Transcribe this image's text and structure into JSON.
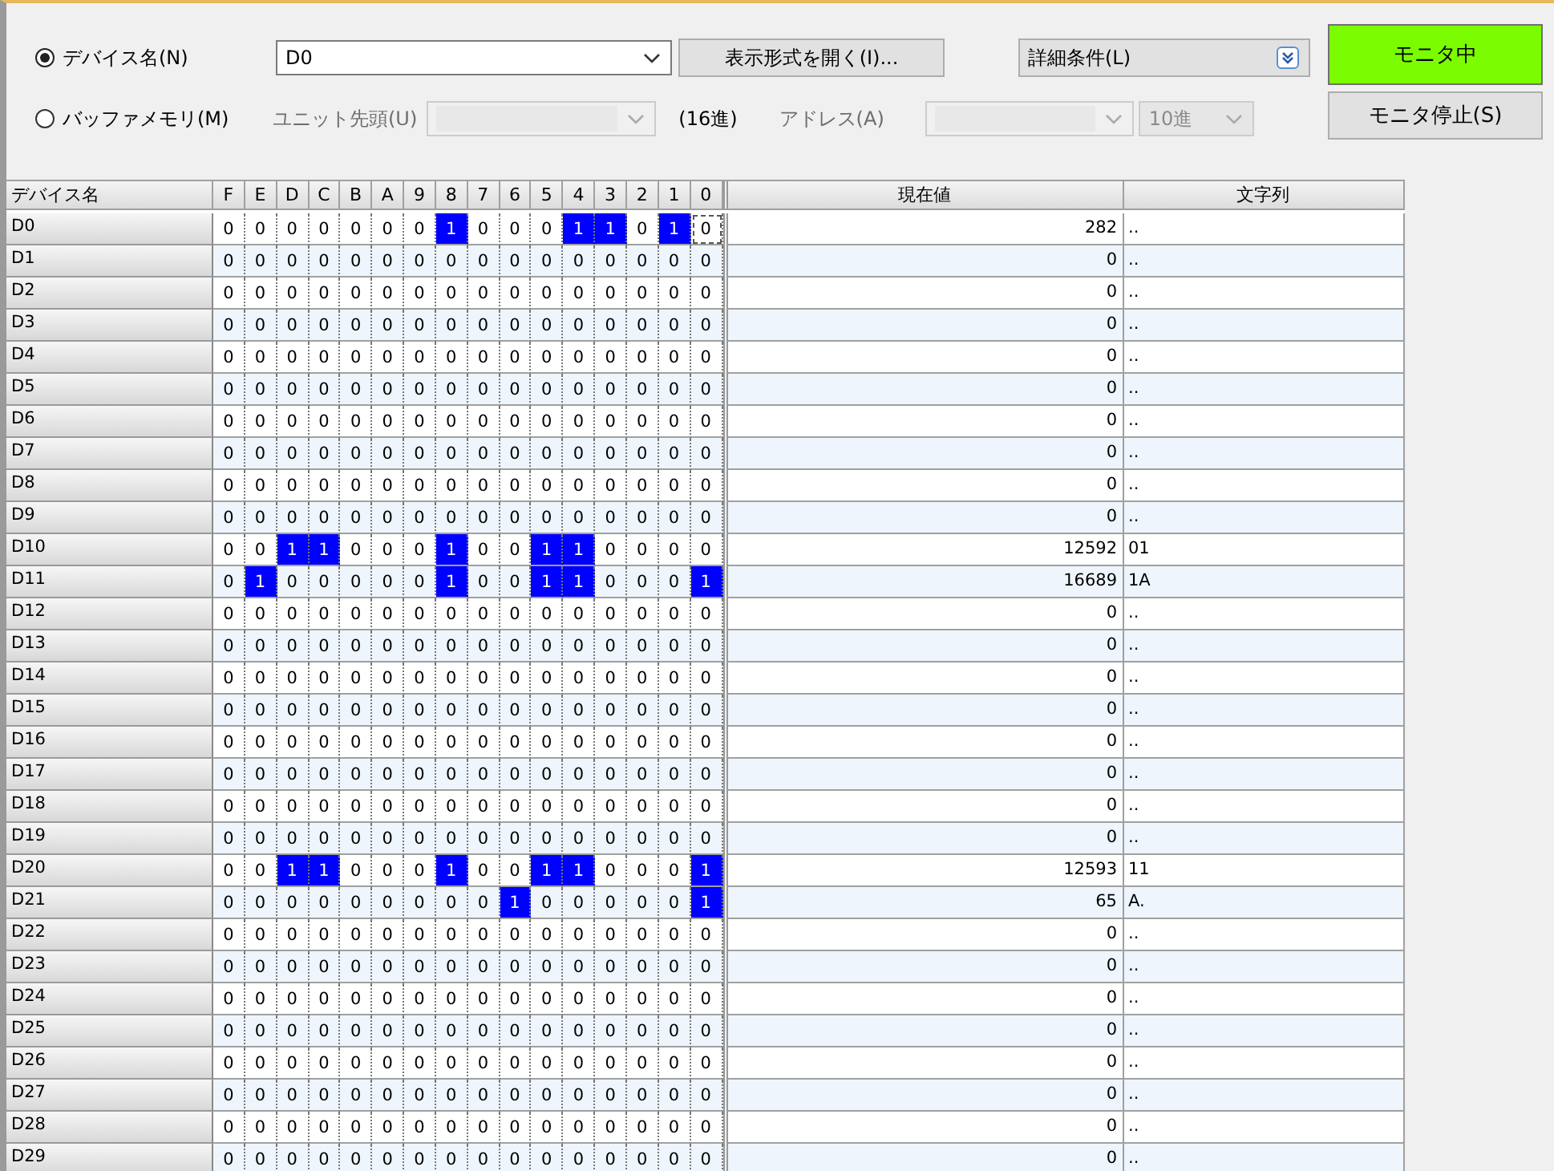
{
  "radios": [
    {
      "label": "デバイス名(N)",
      "selected": true
    },
    {
      "label": "バッファメモリ(M)",
      "selected": false
    }
  ],
  "device_field": {
    "value": "D0"
  },
  "open_format_button": "表示形式を開く(I)...",
  "detail_condition": {
    "value": "詳細条件(L)"
  },
  "monitor_button": {
    "label": "モニタ中",
    "active": true
  },
  "stop_button": "モニタ停止(S)",
  "unit_start": {
    "label": "ユニット先頭(U)",
    "disabled": true
  },
  "unit_radix": "(16進)",
  "address": {
    "label": "アドレス(A)",
    "disabled": true
  },
  "address_radix": {
    "value": "10進",
    "disabled": true
  },
  "table": {
    "columns": [
      "デバイス名",
      "F",
      "E",
      "D",
      "C",
      "B",
      "A",
      "9",
      "8",
      "7",
      "6",
      "5",
      "4",
      "3",
      "2",
      "1",
      "0",
      "現在値",
      "文字列"
    ],
    "rows": [
      {
        "name": "D0",
        "focused": true,
        "bits": [
          "0",
          "0",
          "0",
          "0",
          "0",
          "0",
          "0",
          "1",
          "0",
          "0",
          "0",
          "1",
          "1",
          "0",
          "1",
          "0"
        ],
        "value": "282",
        "text": ".."
      },
      {
        "name": "D1",
        "focused": false,
        "bits": [
          "0",
          "0",
          "0",
          "0",
          "0",
          "0",
          "0",
          "0",
          "0",
          "0",
          "0",
          "0",
          "0",
          "0",
          "0",
          "0"
        ],
        "value": "0",
        "text": ".."
      },
      {
        "name": "D2",
        "focused": false,
        "bits": [
          "0",
          "0",
          "0",
          "0",
          "0",
          "0",
          "0",
          "0",
          "0",
          "0",
          "0",
          "0",
          "0",
          "0",
          "0",
          "0"
        ],
        "value": "0",
        "text": ".."
      },
      {
        "name": "D3",
        "focused": false,
        "bits": [
          "0",
          "0",
          "0",
          "0",
          "0",
          "0",
          "0",
          "0",
          "0",
          "0",
          "0",
          "0",
          "0",
          "0",
          "0",
          "0"
        ],
        "value": "0",
        "text": ".."
      },
      {
        "name": "D4",
        "focused": false,
        "bits": [
          "0",
          "0",
          "0",
          "0",
          "0",
          "0",
          "0",
          "0",
          "0",
          "0",
          "0",
          "0",
          "0",
          "0",
          "0",
          "0"
        ],
        "value": "0",
        "text": ".."
      },
      {
        "name": "D5",
        "focused": false,
        "bits": [
          "0",
          "0",
          "0",
          "0",
          "0",
          "0",
          "0",
          "0",
          "0",
          "0",
          "0",
          "0",
          "0",
          "0",
          "0",
          "0"
        ],
        "value": "0",
        "text": ".."
      },
      {
        "name": "D6",
        "focused": false,
        "bits": [
          "0",
          "0",
          "0",
          "0",
          "0",
          "0",
          "0",
          "0",
          "0",
          "0",
          "0",
          "0",
          "0",
          "0",
          "0",
          "0"
        ],
        "value": "0",
        "text": ".."
      },
      {
        "name": "D7",
        "focused": false,
        "bits": [
          "0",
          "0",
          "0",
          "0",
          "0",
          "0",
          "0",
          "0",
          "0",
          "0",
          "0",
          "0",
          "0",
          "0",
          "0",
          "0"
        ],
        "value": "0",
        "text": ".."
      },
      {
        "name": "D8",
        "focused": false,
        "bits": [
          "0",
          "0",
          "0",
          "0",
          "0",
          "0",
          "0",
          "0",
          "0",
          "0",
          "0",
          "0",
          "0",
          "0",
          "0",
          "0"
        ],
        "value": "0",
        "text": ".."
      },
      {
        "name": "D9",
        "focused": false,
        "bits": [
          "0",
          "0",
          "0",
          "0",
          "0",
          "0",
          "0",
          "0",
          "0",
          "0",
          "0",
          "0",
          "0",
          "0",
          "0",
          "0"
        ],
        "value": "0",
        "text": ".."
      },
      {
        "name": "D10",
        "focused": false,
        "bits": [
          "0",
          "0",
          "1",
          "1",
          "0",
          "0",
          "0",
          "1",
          "0",
          "0",
          "1",
          "1",
          "0",
          "0",
          "0",
          "0"
        ],
        "value": "12592",
        "text": "01"
      },
      {
        "name": "D11",
        "focused": false,
        "bits": [
          "0",
          "1",
          "0",
          "0",
          "0",
          "0",
          "0",
          "1",
          "0",
          "0",
          "1",
          "1",
          "0",
          "0",
          "0",
          "1"
        ],
        "value": "16689",
        "text": "1A"
      },
      {
        "name": "D12",
        "focused": false,
        "bits": [
          "0",
          "0",
          "0",
          "0",
          "0",
          "0",
          "0",
          "0",
          "0",
          "0",
          "0",
          "0",
          "0",
          "0",
          "0",
          "0"
        ],
        "value": "0",
        "text": ".."
      },
      {
        "name": "D13",
        "focused": false,
        "bits": [
          "0",
          "0",
          "0",
          "0",
          "0",
          "0",
          "0",
          "0",
          "0",
          "0",
          "0",
          "0",
          "0",
          "0",
          "0",
          "0"
        ],
        "value": "0",
        "text": ".."
      },
      {
        "name": "D14",
        "focused": false,
        "bits": [
          "0",
          "0",
          "0",
          "0",
          "0",
          "0",
          "0",
          "0",
          "0",
          "0",
          "0",
          "0",
          "0",
          "0",
          "0",
          "0"
        ],
        "value": "0",
        "text": ".."
      },
      {
        "name": "D15",
        "focused": false,
        "bits": [
          "0",
          "0",
          "0",
          "0",
          "0",
          "0",
          "0",
          "0",
          "0",
          "0",
          "0",
          "0",
          "0",
          "0",
          "0",
          "0"
        ],
        "value": "0",
        "text": ".."
      },
      {
        "name": "D16",
        "focused": false,
        "bits": [
          "0",
          "0",
          "0",
          "0",
          "0",
          "0",
          "0",
          "0",
          "0",
          "0",
          "0",
          "0",
          "0",
          "0",
          "0",
          "0"
        ],
        "value": "0",
        "text": ".."
      },
      {
        "name": "D17",
        "focused": false,
        "bits": [
          "0",
          "0",
          "0",
          "0",
          "0",
          "0",
          "0",
          "0",
          "0",
          "0",
          "0",
          "0",
          "0",
          "0",
          "0",
          "0"
        ],
        "value": "0",
        "text": ".."
      },
      {
        "name": "D18",
        "focused": false,
        "bits": [
          "0",
          "0",
          "0",
          "0",
          "0",
          "0",
          "0",
          "0",
          "0",
          "0",
          "0",
          "0",
          "0",
          "0",
          "0",
          "0"
        ],
        "value": "0",
        "text": ".."
      },
      {
        "name": "D19",
        "focused": false,
        "bits": [
          "0",
          "0",
          "0",
          "0",
          "0",
          "0",
          "0",
          "0",
          "0",
          "0",
          "0",
          "0",
          "0",
          "0",
          "0",
          "0"
        ],
        "value": "0",
        "text": ".."
      },
      {
        "name": "D20",
        "focused": false,
        "bits": [
          "0",
          "0",
          "1",
          "1",
          "0",
          "0",
          "0",
          "1",
          "0",
          "0",
          "1",
          "1",
          "0",
          "0",
          "0",
          "1"
        ],
        "value": "12593",
        "text": "11"
      },
      {
        "name": "D21",
        "focused": false,
        "bits": [
          "0",
          "0",
          "0",
          "0",
          "0",
          "0",
          "0",
          "0",
          "0",
          "1",
          "0",
          "0",
          "0",
          "0",
          "0",
          "1"
        ],
        "value": "65",
        "text": "A."
      },
      {
        "name": "D22",
        "focused": false,
        "bits": [
          "0",
          "0",
          "0",
          "0",
          "0",
          "0",
          "0",
          "0",
          "0",
          "0",
          "0",
          "0",
          "0",
          "0",
          "0",
          "0"
        ],
        "value": "0",
        "text": ".."
      },
      {
        "name": "D23",
        "focused": false,
        "bits": [
          "0",
          "0",
          "0",
          "0",
          "0",
          "0",
          "0",
          "0",
          "0",
          "0",
          "0",
          "0",
          "0",
          "0",
          "0",
          "0"
        ],
        "value": "0",
        "text": ".."
      },
      {
        "name": "D24",
        "focused": false,
        "bits": [
          "0",
          "0",
          "0",
          "0",
          "0",
          "0",
          "0",
          "0",
          "0",
          "0",
          "0",
          "0",
          "0",
          "0",
          "0",
          "0"
        ],
        "value": "0",
        "text": ".."
      },
      {
        "name": "D25",
        "focused": false,
        "bits": [
          "0",
          "0",
          "0",
          "0",
          "0",
          "0",
          "0",
          "0",
          "0",
          "0",
          "0",
          "0",
          "0",
          "0",
          "0",
          "0"
        ],
        "value": "0",
        "text": ".."
      },
      {
        "name": "D26",
        "focused": false,
        "bits": [
          "0",
          "0",
          "0",
          "0",
          "0",
          "0",
          "0",
          "0",
          "0",
          "0",
          "0",
          "0",
          "0",
          "0",
          "0",
          "0"
        ],
        "value": "0",
        "text": ".."
      },
      {
        "name": "D27",
        "focused": false,
        "bits": [
          "0",
          "0",
          "0",
          "0",
          "0",
          "0",
          "0",
          "0",
          "0",
          "0",
          "0",
          "0",
          "0",
          "0",
          "0",
          "0"
        ],
        "value": "0",
        "text": ".."
      },
      {
        "name": "D28",
        "focused": false,
        "bits": [
          "0",
          "0",
          "0",
          "0",
          "0",
          "0",
          "0",
          "0",
          "0",
          "0",
          "0",
          "0",
          "0",
          "0",
          "0",
          "0"
        ],
        "value": "0",
        "text": ".."
      },
      {
        "name": "D29",
        "focused": false,
        "bits": [
          "0",
          "0",
          "0",
          "0",
          "0",
          "0",
          "0",
          "0",
          "0",
          "0",
          "0",
          "0",
          "0",
          "0",
          "0",
          "0"
        ],
        "value": "0",
        "text": ".."
      }
    ]
  }
}
